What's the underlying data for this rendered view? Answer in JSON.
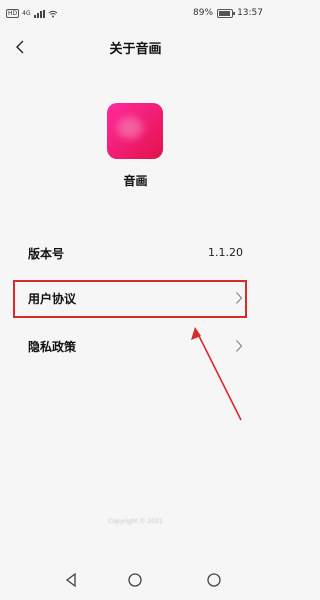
{
  "status_bar": {
    "sim_label": "HD",
    "network_label": "4G",
    "battery_percent": "89%",
    "battery_level": 0.89,
    "time": "13:57"
  },
  "header": {
    "title": "关于音画"
  },
  "app": {
    "name": "音画",
    "icon_colors": [
      "#ff2aa0",
      "#e3124a"
    ]
  },
  "info": {
    "version_label": "版本号",
    "version_value": "1.1.20"
  },
  "menu": {
    "agreement_label": "用户协议",
    "privacy_label": "隐私政策"
  },
  "footer": {
    "copyright": "Copyright © 2021"
  },
  "annotation": {
    "highlight_color": "#d62b2b"
  }
}
